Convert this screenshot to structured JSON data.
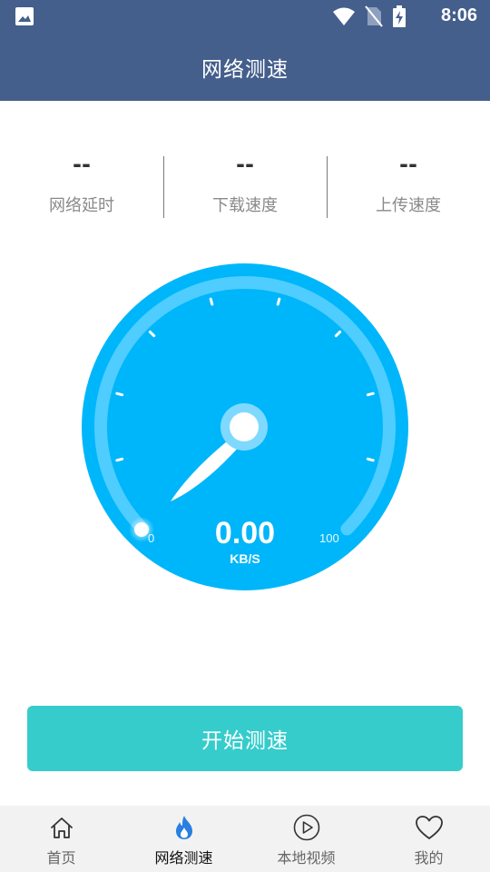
{
  "status_bar": {
    "time": "8:06"
  },
  "app_bar": {
    "title": "网络测速"
  },
  "metrics": [
    {
      "value": "--",
      "label": "网络延时"
    },
    {
      "value": "--",
      "label": "下载速度"
    },
    {
      "value": "--",
      "label": "上传速度"
    }
  ],
  "gauge": {
    "speed": "0.00",
    "unit": "KB/S",
    "min_label": "0",
    "max_label": "100"
  },
  "start_button": {
    "label": "开始测速"
  },
  "bottom_nav": {
    "items": [
      {
        "label": "首页",
        "icon": "home-icon"
      },
      {
        "label": "网络测速",
        "icon": "flame-icon",
        "active": true
      },
      {
        "label": "本地视频",
        "icon": "play-circle-icon"
      },
      {
        "label": "我的",
        "icon": "heart-icon"
      }
    ]
  },
  "colors": {
    "app_bar": "#445f8c",
    "gauge": "#00b6fa",
    "button": "#36cccc",
    "nav_active_icon": "#2a7fe0"
  }
}
